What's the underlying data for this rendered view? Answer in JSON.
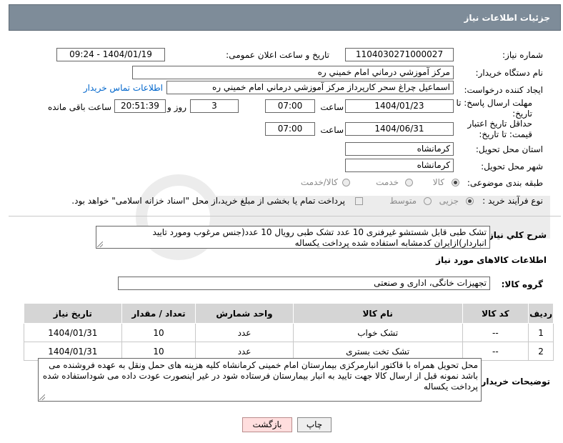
{
  "header": {
    "title": "جزئیات اطلاعات نیاز"
  },
  "fields": {
    "need_no_label": "شماره نیاز:",
    "need_no": "1104030271000027",
    "announce_label": "تاریخ و ساعت اعلان عمومی:",
    "announce_value": "1404/01/19 - 09:24",
    "buyer_label": "نام دستگاه خریدار:",
    "buyer": "مرکز آموزشي درماني امام خميني ره",
    "creator_label": "ایجاد کننده درخواست:",
    "creator": "اسماعیل چراغ سحر کارپرداز مرکز آموزشي درماني امام خميني ره",
    "contact_link": "اطلاعات تماس خریدار",
    "reply_deadline_label": "مهلت ارسال پاسخ: تا تاریخ:",
    "reply_date": "1404/01/23",
    "time_label": "ساعت",
    "reply_time": "07:00",
    "days_value": "3",
    "days_label": "روز و",
    "remaining_time": "20:51:39",
    "remaining_label": "ساعت باقی مانده",
    "price_deadline_label": "حداقل تاریخ اعتبار قیمت: تا تاریخ:",
    "price_date": "1404/06/31",
    "price_time": "07:00",
    "province_label": "استان محل تحویل:",
    "province": "کرمانشاه",
    "city_label": "شهر محل تحویل:",
    "city": "کرمانشاه",
    "category_label": "طبقه بندی موضوعی:",
    "category_options": [
      "کالا",
      "خدمت",
      "کالا/خدمت"
    ],
    "process_label": "نوع فرآیند خرید :",
    "process_options": [
      "جزیی",
      "متوسط"
    ],
    "payment_note": "پرداخت تمام یا بخشی از مبلغ خرید،از محل \"اسناد خزانه اسلامی\" خواهد بود."
  },
  "description": {
    "label": "شرح کلي نياز:",
    "text": "تشک طبی قابل شستشو غیرفنری 10 عدد تشک طبی رویال 10 عدد(جنس مرغوب  ومورد تایید انباردار)ازایران کدمشابه استفاده شده پرداخت یکساله"
  },
  "goods_section": {
    "title": "اطلاعات کالاهای مورد نیاز",
    "group_label": "گروه کالا:",
    "group_value": "تجهیزات خانگی، اداری و صنعتی"
  },
  "table": {
    "headers": [
      "ردیف",
      "کد کالا",
      "نام کالا",
      "واحد شمارش",
      "تعداد / مقدار",
      "تاریخ نیاز"
    ],
    "rows": [
      [
        "1",
        "--",
        "تشک خواب",
        "عدد",
        "10",
        "1404/01/31"
      ],
      [
        "2",
        "--",
        "تشک تخت بستری",
        "عدد",
        "10",
        "1404/01/31"
      ]
    ]
  },
  "buyer_notes": {
    "label": "توضیحات خریدار:",
    "text": "محل تحویل همراه  با فاکتور انبارمرکزی بیمارستان امام خمینی کرمانشاه کلیه هزینه های حمل ونقل به عهده فروشنده می باشد نمونه قبل از ارسال کالا جهت تایید به انبار بیمارستان فرستاده شود در غیر اینصورت عودت داده می شوداستفاده شده پرداخت یکساله"
  },
  "buttons": {
    "print": "چاپ",
    "back": "بازگشت"
  }
}
